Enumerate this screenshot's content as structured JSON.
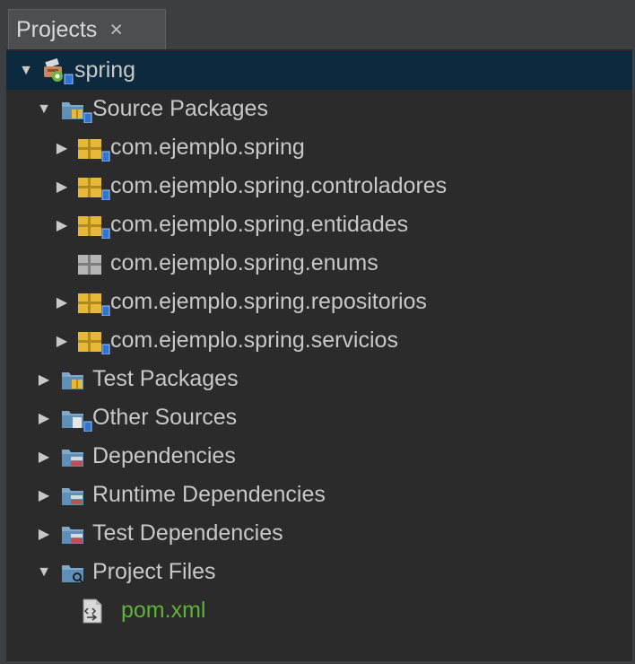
{
  "panel": {
    "tab_label": "Projects",
    "close_glyph": "×"
  },
  "tree": {
    "project": {
      "label": "spring",
      "expanded": true,
      "icon": "maven-project-icon"
    },
    "source_packages": {
      "label": "Source Packages",
      "expanded": true,
      "icon": "source-packages-folder-icon"
    },
    "packages": [
      {
        "label": "com.ejemplo.spring",
        "icon": "java-package-icon",
        "expandable": true
      },
      {
        "label": "com.ejemplo.spring.controladores",
        "icon": "java-package-icon",
        "expandable": true
      },
      {
        "label": "com.ejemplo.spring.entidades",
        "icon": "java-package-icon",
        "expandable": true
      },
      {
        "label": "com.ejemplo.spring.enums",
        "icon": "empty-package-icon",
        "expandable": false
      },
      {
        "label": "com.ejemplo.spring.repositorios",
        "icon": "java-package-icon",
        "expandable": true
      },
      {
        "label": "com.ejemplo.spring.servicios",
        "icon": "java-package-icon",
        "expandable": true
      }
    ],
    "test_packages": {
      "label": "Test Packages",
      "icon": "test-packages-folder-icon"
    },
    "other_sources": {
      "label": "Other Sources",
      "icon": "other-sources-folder-icon"
    },
    "dependencies": {
      "label": "Dependencies",
      "icon": "libraries-folder-icon"
    },
    "runtime_dependencies": {
      "label": "Runtime Dependencies",
      "icon": "libraries-folder-icon"
    },
    "test_dependencies": {
      "label": "Test Dependencies",
      "icon": "libraries-folder-icon"
    },
    "project_files": {
      "label": "Project Files",
      "expanded": true,
      "icon": "project-files-folder-icon"
    },
    "pom": {
      "label": "pom.xml",
      "icon": "xml-file-icon"
    }
  },
  "colors": {
    "background": "#2b2b2b",
    "selection": "#0d293e",
    "text": "#c8c8c8",
    "modified_file": "#5fb23a",
    "package_icon": "#e8b936"
  }
}
